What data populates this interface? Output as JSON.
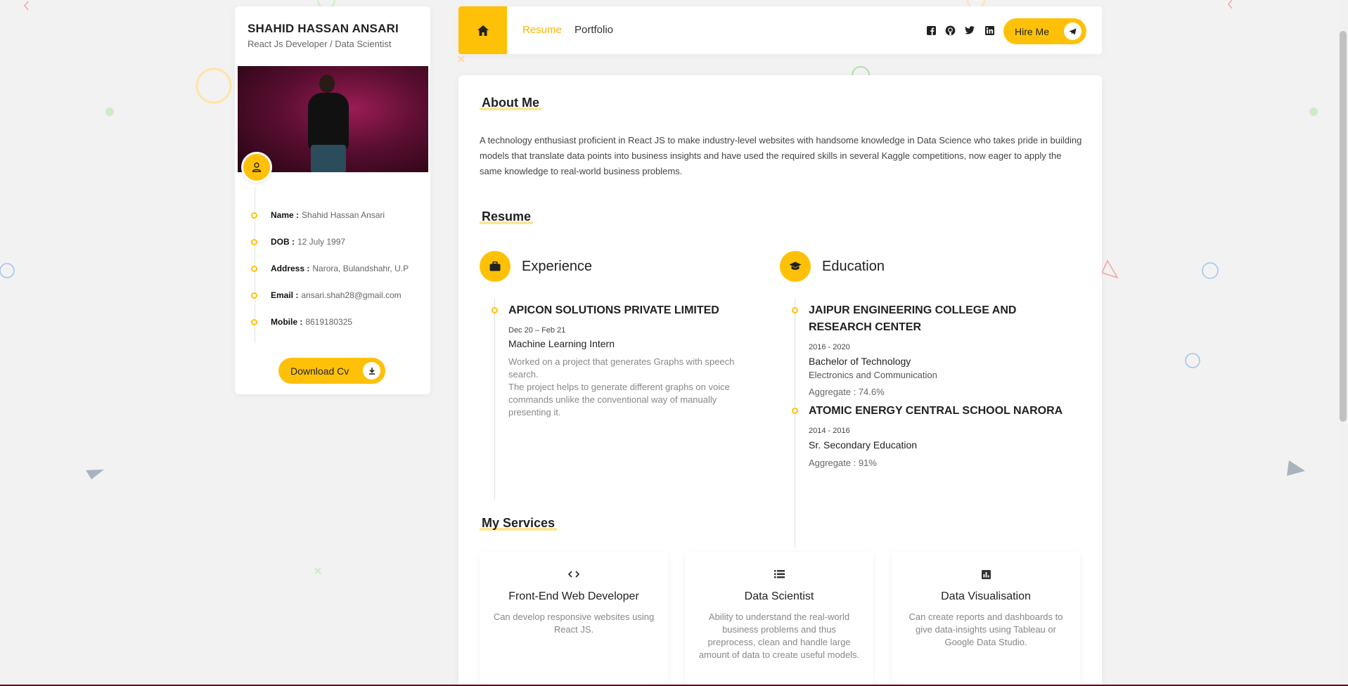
{
  "profile": {
    "name": "SHAHID HASSAN ANSARI",
    "role": "React Js Developer / Data Scientist",
    "info": [
      {
        "key": "Name :",
        "value": "Shahid Hassan Ansari"
      },
      {
        "key": "DOB :",
        "value": "12 July 1997"
      },
      {
        "key": "Address :",
        "value": "Narora, Bulandshahr, U.P"
      },
      {
        "key": "Email :",
        "value": "ansari.shah28@gmail.com"
      },
      {
        "key": "Mobile :",
        "value": "8619180325"
      }
    ],
    "download_label": "Download Cv"
  },
  "nav": {
    "links": [
      "Resume",
      "Portfolio"
    ],
    "active": "Resume",
    "social_icons": [
      "facebook-icon",
      "github-icon",
      "twitter-icon",
      "linkedin-icon"
    ],
    "hire_label": "Hire Me"
  },
  "about": {
    "title": "About Me",
    "text": "A technology enthusiast proficient in React JS to make industry-level websites with handsome knowledge in Data Science who takes pride in building models that translate data points into business insights and have used the required skills in several Kaggle competitions, now eager to apply the same knowledge to real-world business problems."
  },
  "resume": {
    "title": "Resume",
    "experience": {
      "heading": "Experience",
      "items": [
        {
          "company": "APICON SOLUTIONS PRIVATE LIMITED",
          "date": "Dec 20 – Feb 21",
          "position": "Machine Learning Intern",
          "desc1": "Worked on a project that generates Graphs with speech search.",
          "desc2": "The project helps to generate different graphs on voice commands unlike the conventional way of manually presenting it."
        }
      ]
    },
    "education": {
      "heading": "Education",
      "items": [
        {
          "school": "JAIPUR ENGINEERING COLLEGE AND RESEARCH CENTER",
          "date": "2016 - 2020",
          "degree": "Bachelor of Technology",
          "branch": "Electronics and Communication",
          "aggregate": "Aggregate : 74.6%"
        },
        {
          "school": "ATOMIC ENERGY CENTRAL SCHOOL NARORA",
          "date": "2014 - 2016",
          "degree": "Sr. Secondary Education",
          "aggregate": "Aggregate : 91%"
        }
      ]
    }
  },
  "services": {
    "title": "My Services",
    "items": [
      {
        "icon": "code-icon",
        "title": "Front-End Web Developer",
        "desc": "Can develop responsive websites using React JS."
      },
      {
        "icon": "list-icon",
        "title": "Data Scientist",
        "desc": "Ability to understand the real-world business problems and thus preprocess, clean and handle large amount of data to create useful models."
      },
      {
        "icon": "bar-chart-icon",
        "title": "Data Visualisation",
        "desc": "Can create reports and dashboards to give data-insights using Tableau or Google Data Studio."
      }
    ]
  },
  "colors": {
    "accent": "#ffc107",
    "background": "#f2f2f2"
  }
}
